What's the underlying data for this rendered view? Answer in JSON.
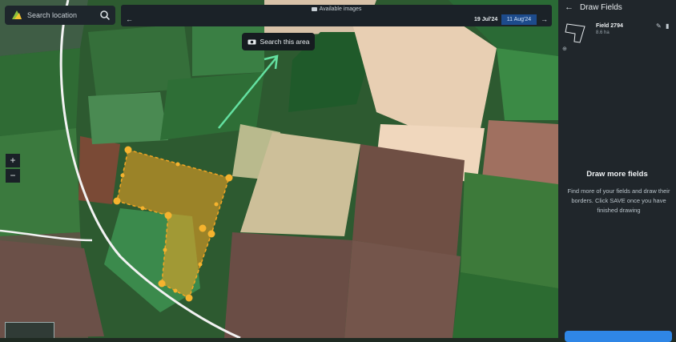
{
  "search": {
    "placeholder": "Search location"
  },
  "timeline": {
    "caption": "Available images",
    "dates": [
      "19 Jul'24",
      "11 Aug'24"
    ],
    "selected": "11 Aug'24"
  },
  "map": {
    "search_area_label": "Search this area",
    "zoom_in": "+",
    "zoom_out": "−",
    "field_color": "#f5a623"
  },
  "panel": {
    "title": "Draw Fields",
    "field": {
      "name": "Field 2794",
      "area": "8.6 ha"
    },
    "more_title": "Draw more fields",
    "more_text": "Find more of your fields and draw their borders. Click SAVE once you have finished drawing",
    "accent": "#2f86e6"
  }
}
